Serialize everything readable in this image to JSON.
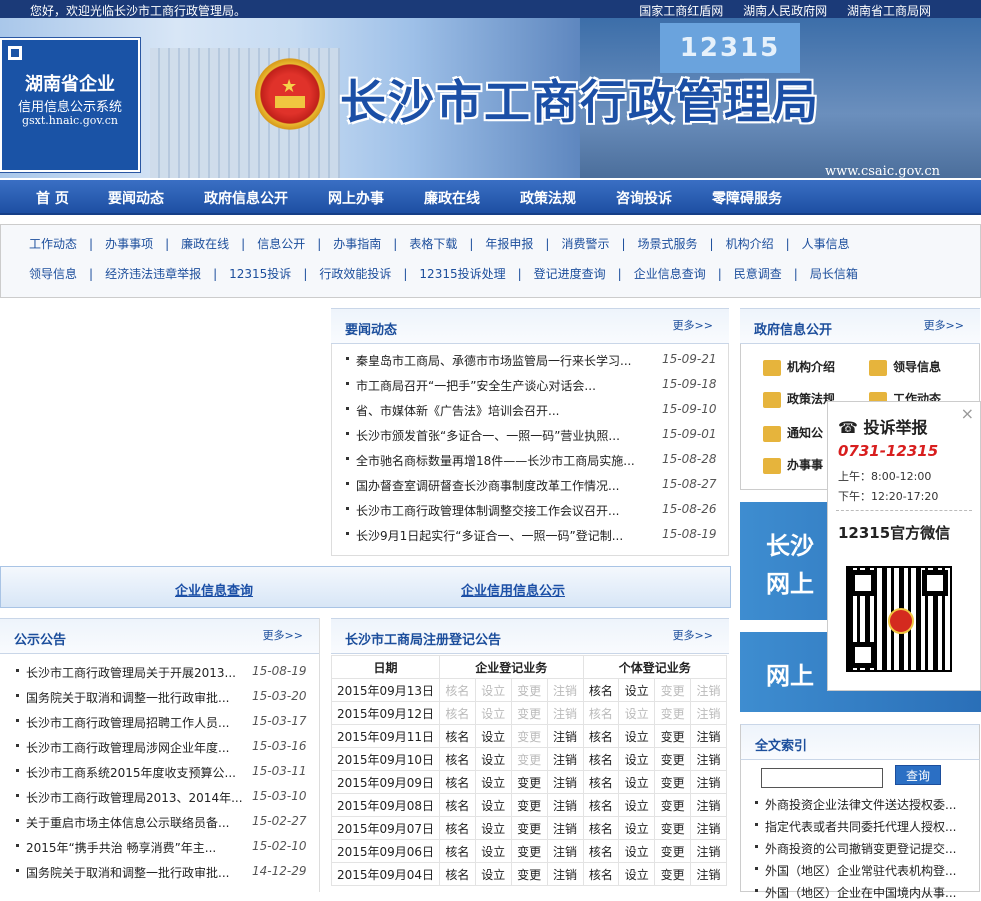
{
  "topbar": {
    "welcome": "您好，欢迎光临长沙市工商行政管理局。",
    "links": [
      "国家工商红盾网",
      "湖南人民政府网",
      "湖南省工商局网"
    ]
  },
  "banner": {
    "title": "长沙市工商行政管理局",
    "url": "www.csaic.gov.cn",
    "screen": "12315",
    "badge": {
      "line1": "湖南省企业",
      "line2": "信用信息公示系统",
      "line3": "gsxt.hnaic.gov.cn"
    }
  },
  "nav": [
    "首 页",
    "要闻动态",
    "政府信息公开",
    "网上办事",
    "廉政在线",
    "政策法规",
    "咨询投诉",
    "零障碍服务"
  ],
  "subnav": {
    "row1": [
      "工作动态",
      "办事事项",
      "廉政在线",
      "信息公开",
      "办事指南",
      "表格下载",
      "年报申报",
      "消费警示",
      "场景式服务",
      "机构介绍",
      "人事信息"
    ],
    "row2": [
      "领导信息",
      "经济违法违章举报",
      "12315投诉",
      "行政效能投诉",
      "12315投诉处理",
      "登记进度查询",
      "企业信息查询",
      "民意调查",
      "局长信箱"
    ]
  },
  "news": {
    "title": "要闻动态",
    "more": "更多>>",
    "items": [
      {
        "text": "秦皇岛市工商局、承德市市场监管局一行来长学习...",
        "date": "15-09-21"
      },
      {
        "text": "市工商局召开“一把手”安全生产谈心对话会...",
        "date": "15-09-18"
      },
      {
        "text": "省、市媒体新《广告法》培训会召开...",
        "date": "15-09-10"
      },
      {
        "text": "长沙市颁发首张“多证合一、一照一码”营业执照...",
        "date": "15-09-01"
      },
      {
        "text": "全市驰名商标数量再增18件——长沙市工商局实施...",
        "date": "15-08-28"
      },
      {
        "text": "国办督查室调研督查长沙商事制度改革工作情况...",
        "date": "15-08-27"
      },
      {
        "text": "长沙市工商行政管理体制调整交接工作会议召开...",
        "date": "15-08-26"
      },
      {
        "text": "长沙9月1日起实行“多证合一、一照一码”登记制...",
        "date": "15-08-19"
      }
    ]
  },
  "bluebar": {
    "left": "企业信息查询",
    "right": "企业信用信息公示"
  },
  "notice": {
    "title": "公示公告",
    "more": "更多>>",
    "items": [
      {
        "text": "长沙市工商行政管理局关于开展2013...",
        "date": "15-08-19"
      },
      {
        "text": "国务院关于取消和调整一批行政审批...",
        "date": "15-03-20"
      },
      {
        "text": "长沙市工商行政管理局招聘工作人员...",
        "date": "15-03-17"
      },
      {
        "text": "长沙市工商行政管理局涉网企业年度...",
        "date": "15-03-16"
      },
      {
        "text": "长沙市工商系统2015年度收支预算公...",
        "date": "15-03-11"
      },
      {
        "text": "长沙市工商行政管理局2013、2014年...",
        "date": "15-03-10"
      },
      {
        "text": "关于重启市场主体信息公示联络员备...",
        "date": "15-02-27"
      },
      {
        "text": "2015年“携手共治 畅享消费”年主...",
        "date": "15-02-10"
      },
      {
        "text": "国务院关于取消和调整一批行政审批...",
        "date": "14-12-29"
      }
    ]
  },
  "register": {
    "title": "长沙市工商局注册登记公告",
    "more": "更多>>",
    "headers": [
      "日期",
      "企业登记业务",
      "个体登记业务"
    ],
    "actions": [
      "核名",
      "设立",
      "变更",
      "注销"
    ],
    "rows": [
      {
        "date": "2015年09月13日",
        "ent": [
          0,
          0,
          0,
          0
        ],
        "ind": [
          1,
          1,
          0,
          0
        ]
      },
      {
        "date": "2015年09月12日",
        "ent": [
          0,
          0,
          0,
          0
        ],
        "ind": [
          0,
          0,
          0,
          0
        ]
      },
      {
        "date": "2015年09月11日",
        "ent": [
          1,
          1,
          0,
          1
        ],
        "ind": [
          1,
          1,
          1,
          1
        ]
      },
      {
        "date": "2015年09月10日",
        "ent": [
          1,
          1,
          0,
          1
        ],
        "ind": [
          1,
          1,
          1,
          1
        ]
      },
      {
        "date": "2015年09月09日",
        "ent": [
          1,
          1,
          1,
          1
        ],
        "ind": [
          1,
          1,
          1,
          1
        ]
      },
      {
        "date": "2015年09月08日",
        "ent": [
          1,
          1,
          1,
          1
        ],
        "ind": [
          1,
          1,
          1,
          1
        ]
      },
      {
        "date": "2015年09月07日",
        "ent": [
          1,
          1,
          1,
          1
        ],
        "ind": [
          1,
          1,
          1,
          1
        ]
      },
      {
        "date": "2015年09月06日",
        "ent": [
          1,
          1,
          1,
          1
        ],
        "ind": [
          1,
          1,
          1,
          1
        ]
      },
      {
        "date": "2015年09月04日",
        "ent": [
          1,
          1,
          1,
          1
        ],
        "ind": [
          1,
          1,
          1,
          1
        ]
      }
    ]
  },
  "gov": {
    "title": "政府信息公开",
    "more": "更多>>",
    "items": [
      "机构介绍",
      "领导信息",
      "政策法规",
      "工作动态",
      "通知公",
      "办事事"
    ]
  },
  "promo": {
    "a": "长沙",
    "b": "网上",
    "c": "网上"
  },
  "search": {
    "title": "全文索引",
    "button": "查询",
    "value": "",
    "items": [
      "外商投资企业法律文件送达授权委...",
      "指定代表或者共同委托代理人授权...",
      "外商投资的公司撤销变更登记提交...",
      "外国（地区）企业常驻代表机构登...",
      "外国（地区）企业在中国境内从事..."
    ]
  },
  "popup": {
    "close": "×",
    "heading": "投诉举报",
    "phone": "0731-12315",
    "am": "上午：8:00-12:00",
    "pm": "下午：12:20-17:20",
    "wechat": "12315官方微信"
  }
}
